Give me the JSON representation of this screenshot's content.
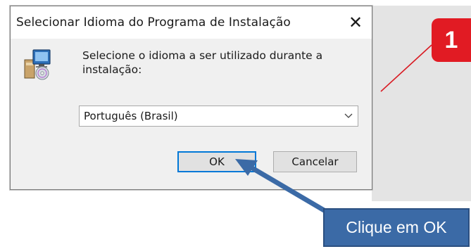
{
  "dialog": {
    "title": "Selecionar Idioma do Programa de Instalação",
    "close_glyph": "✕",
    "prompt": "Selecione o idioma a ser utilizado durante a instalação:",
    "language_select": {
      "value": "Português (Brasil)"
    },
    "ok_label": "OK",
    "cancel_label": "Cancelar",
    "icon": "installer-setup-icon"
  },
  "annotations": {
    "step_badge": "1",
    "callout_text": "Clique em OK",
    "badge_color": "#e11b23",
    "callout_color": "#3b6aa6"
  }
}
